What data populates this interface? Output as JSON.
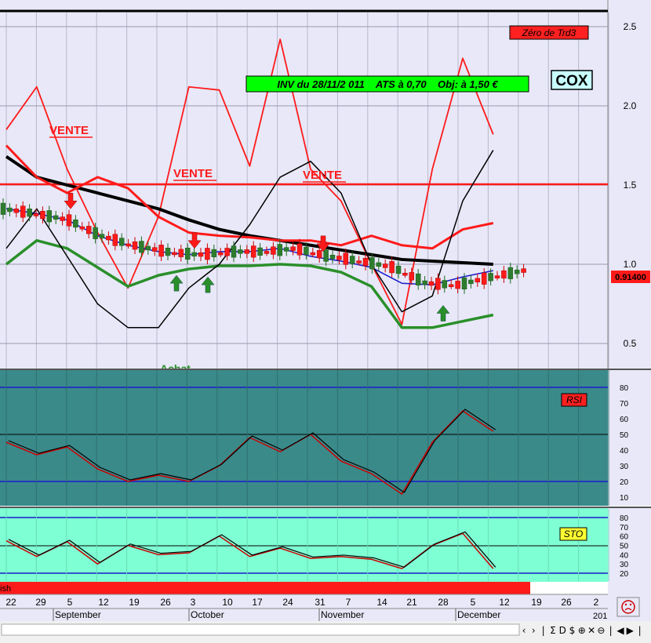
{
  "colors": {
    "price_bg": "#e8e8f8",
    "rsi_bg": "#3a8a8a",
    "sto_bg": "#7fffd4",
    "red": "#ff1a1a",
    "green": "#2a8f2a",
    "blue": "#1a1acc",
    "black": "#000000",
    "signal_green": "#00ff00",
    "label_bg_red": "#ff2020",
    "badge_bg": "#c8ffff"
  },
  "header": {
    "zero_trd3": "Zéro de Trd3",
    "ticker": "COX",
    "inv_note": "INV du 28/11/2 011    ATS à 0,70    Obj: à 1,50 €"
  },
  "price_panel": {
    "last_price": "0.91400",
    "y_axis_ticks": [
      "2.5",
      "2.0",
      "1.5",
      "1.0",
      "0.5"
    ],
    "annotations": [
      "VENTE",
      "VENTE",
      "VENTE",
      "Achat"
    ],
    "buy_arrow_icons": [
      "up-arrow",
      "up-arrow",
      "up-arrow"
    ],
    "sell_arrow_icons": [
      "down-arrow",
      "down-arrow",
      "down-arrow"
    ]
  },
  "rsi_panel": {
    "label": "RSI",
    "y_axis_ticks": [
      "80",
      "70",
      "60",
      "50",
      "40",
      "30",
      "20",
      "10"
    ]
  },
  "sto_panel": {
    "label": "STO",
    "y_axis_ticks": [
      "80",
      "70",
      "60",
      "50",
      "40",
      "30",
      "20"
    ]
  },
  "trend_bar": {
    "label": "ish"
  },
  "x_axis": {
    "day_ticks": [
      "22",
      "29",
      "5",
      "12",
      "19",
      "26",
      "3",
      "10",
      "17",
      "24",
      "31",
      "7",
      "14",
      "21",
      "28",
      "5",
      "12",
      "19",
      "26",
      "2",
      "201"
    ],
    "month_labels": [
      "September",
      "October",
      "November",
      "December"
    ]
  },
  "toolbar": {
    "buttons": [
      "‹",
      "›",
      "|",
      "Σ",
      "D",
      "$",
      "⊕",
      "✕",
      "⊖",
      "|",
      "◀",
      "▶",
      "|"
    ],
    "smiley_icon": "sad-face"
  },
  "chart_data": [
    {
      "type": "line",
      "title": "",
      "x": [
        "22",
        "29",
        "5",
        "12",
        "19",
        "26",
        "3",
        "10",
        "17",
        "24",
        "31",
        "7",
        "14",
        "21",
        "28",
        "5",
        "12"
      ],
      "ylim": [
        0.35,
        2.6
      ],
      "series": [
        {
          "values": [
            1.85,
            2.12,
            1.6,
            1.2,
            0.85,
            1.3,
            2.12,
            2.1,
            1.62,
            2.42,
            1.6,
            1.4,
            1.0,
            0.62,
            1.6,
            2.3,
            1.82
          ]
        },
        {
          "values": [
            1.68,
            1.55,
            1.5,
            1.45,
            1.4,
            1.35,
            1.28,
            1.22,
            1.18,
            1.15,
            1.12,
            1.09,
            1.06,
            1.03,
            1.02,
            1.01,
            1.0
          ]
        },
        {
          "values": [
            1.75,
            1.55,
            1.45,
            1.55,
            1.48,
            1.3,
            1.2,
            1.18,
            1.17,
            1.15,
            1.15,
            1.12,
            1.18,
            1.12,
            1.1,
            1.22,
            1.26
          ]
        },
        {
          "values": [
            1.35,
            1.32,
            1.28,
            1.18,
            1.12,
            1.08,
            1.06,
            1.08,
            1.08,
            1.1,
            1.05,
            1.02,
            0.98,
            0.88,
            0.87,
            0.92,
            0.96
          ]
        },
        {
          "values": [
            1.0,
            1.15,
            1.1,
            0.98,
            0.86,
            0.93,
            0.97,
            0.99,
            0.99,
            1.0,
            0.99,
            0.95,
            0.86,
            0.6,
            0.6,
            0.64,
            0.68
          ]
        },
        {
          "values": [
            1.1,
            1.35,
            1.05,
            0.75,
            0.6,
            0.6,
            0.85,
            1.0,
            1.25,
            1.55,
            1.65,
            1.45,
            1.0,
            0.7,
            0.8,
            1.4,
            1.72
          ]
        }
      ]
    },
    {
      "type": "line",
      "title": "RSI",
      "x": [
        "22",
        "29",
        "5",
        "12",
        "19",
        "26",
        "3",
        "10",
        "17",
        "24",
        "31",
        "7",
        "14",
        "21",
        "28",
        "5",
        "12"
      ],
      "ylim": [
        0,
        90
      ],
      "series": [
        {
          "name": "RSI",
          "values": [
            45,
            37,
            42,
            28,
            20,
            24,
            20,
            30,
            48,
            39,
            50,
            33,
            25,
            12,
            45,
            65,
            52
          ]
        }
      ]
    },
    {
      "type": "line",
      "title": "STO",
      "x": [
        "22",
        "29",
        "5",
        "12",
        "19",
        "26",
        "3",
        "10",
        "17",
        "24",
        "31",
        "7",
        "14",
        "21",
        "28",
        "5",
        "12"
      ],
      "ylim": [
        10,
        90
      ],
      "series": [
        {
          "name": "STO",
          "values": [
            55,
            38,
            54,
            30,
            50,
            40,
            42,
            60,
            38,
            47,
            36,
            38,
            35,
            25,
            50,
            63,
            25
          ]
        }
      ]
    }
  ]
}
